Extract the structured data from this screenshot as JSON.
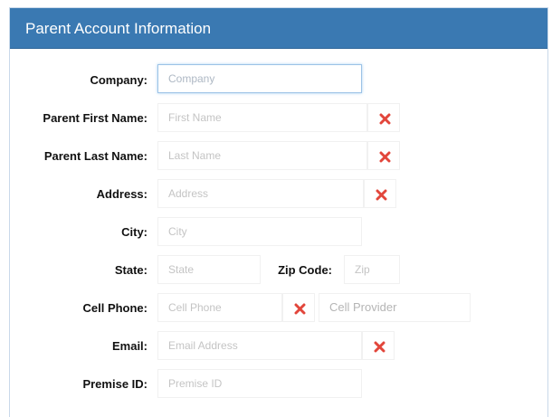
{
  "panel": {
    "title": "Parent Account Information"
  },
  "form": {
    "company": {
      "label": "Company:",
      "placeholder": "Company"
    },
    "first_name": {
      "label": "Parent First Name:",
      "placeholder": "First Name"
    },
    "last_name": {
      "label": "Parent Last Name:",
      "placeholder": "Last Name"
    },
    "address": {
      "label": "Address:",
      "placeholder": "Address"
    },
    "city": {
      "label": "City:",
      "placeholder": "City"
    },
    "state": {
      "label": "State:",
      "placeholder": "State"
    },
    "zip": {
      "label": "Zip Code:",
      "placeholder": "Zip"
    },
    "cell_phone": {
      "label": "Cell Phone:",
      "placeholder": "Cell Phone"
    },
    "cell_provider": {
      "value": "Cell Provider"
    },
    "email": {
      "label": "Email:",
      "placeholder": "Email Address"
    },
    "premise_id": {
      "label": "Premise ID:",
      "placeholder": "Premise ID"
    }
  },
  "colors": {
    "header": "#3a79b2",
    "clear_icon": "#e2463b"
  }
}
